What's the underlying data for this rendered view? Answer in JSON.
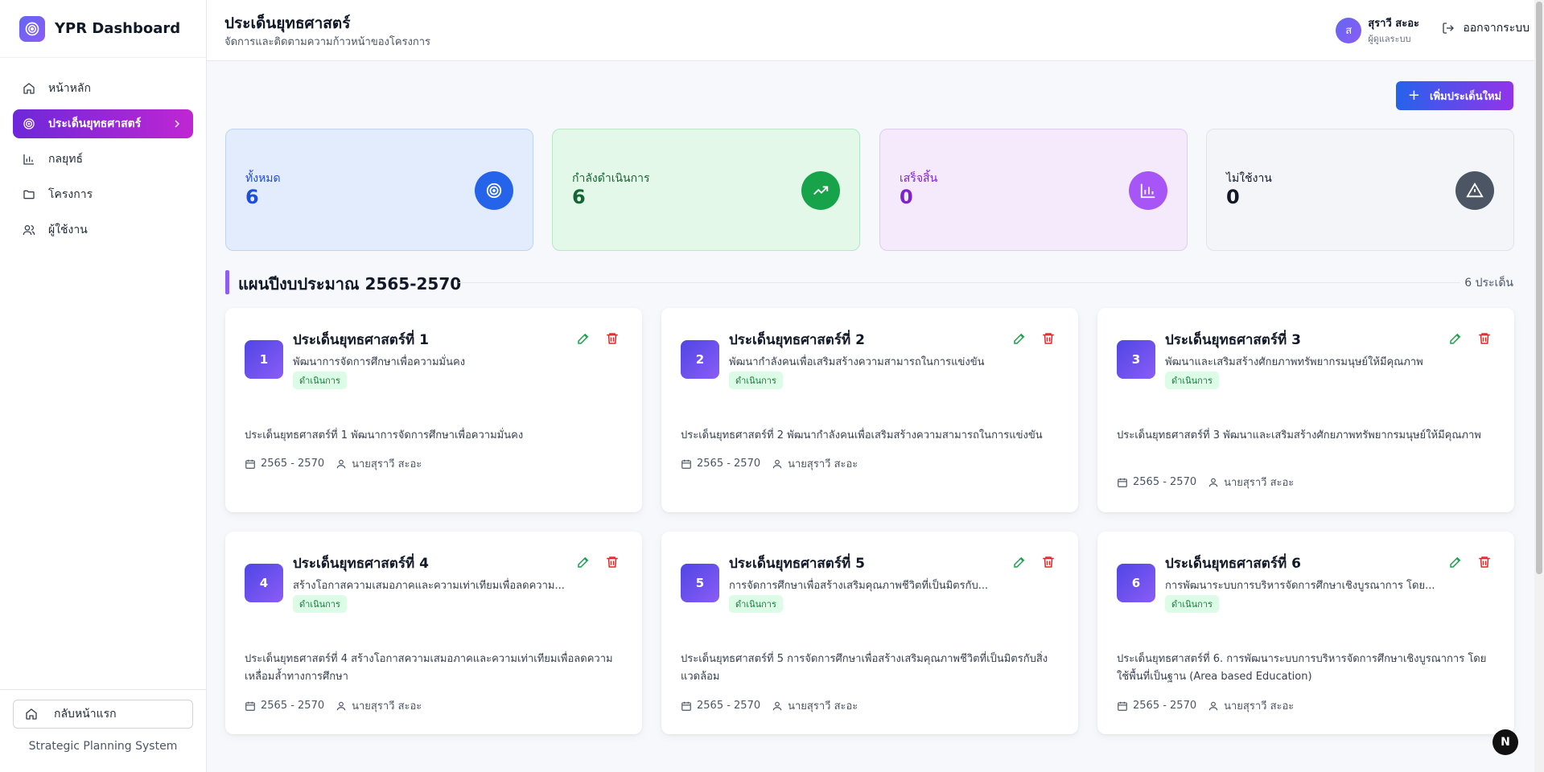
{
  "app": {
    "title": "YPR Dashboard",
    "system_name": "Strategic Planning System"
  },
  "sidebar": {
    "items": [
      {
        "label": "หน้าหลัก",
        "icon": "home-icon"
      },
      {
        "label": "ประเด็นยุทธศาสตร์",
        "icon": "target-icon",
        "active": true
      },
      {
        "label": "กลยุทธ์",
        "icon": "bar-chart-icon"
      },
      {
        "label": "โครงการ",
        "icon": "folder-icon"
      },
      {
        "label": "ผู้ใช้งาน",
        "icon": "users-icon"
      }
    ],
    "footer_button": "กลับหน้าแรก"
  },
  "header": {
    "title": "ประเด็นยุทธศาสตร์",
    "subtitle": "จัดการและติดตามความก้าวหน้าของโครงการ",
    "user": {
      "initial": "ส",
      "name": "สุราวี สะอะ",
      "role": "ผู้ดูแลระบบ"
    },
    "logout_label": "ออกจากระบบ"
  },
  "add_button": "เพิ่มประเด็นใหม่",
  "stats": [
    {
      "label": "ทั้งหมด",
      "value": "6",
      "color": "#1d4ed8",
      "bg": "#e3ecfc",
      "border": "#bfd3f5",
      "icon_bg": "#2563eb",
      "icon": "target-icon"
    },
    {
      "label": "กำลังดำเนินการ",
      "value": "6",
      "color": "#166534",
      "bg": "#e3f8e9",
      "border": "#b6e8c4",
      "icon_bg": "#16a34a",
      "icon": "trending-up-icon"
    },
    {
      "label": "เสร็จสิ้น",
      "value": "0",
      "color": "#7e22ce",
      "bg": "#f5eafc",
      "border": "#e3c9f5",
      "icon_bg": "#a855f7",
      "icon": "bar-chart-icon"
    },
    {
      "label": "ไม่ใช้งาน",
      "value": "0",
      "color": "#111827",
      "bg": "#f3f5f8",
      "border": "#dfe3ea",
      "icon_bg": "#4b5563",
      "icon": "alert-triangle-icon"
    }
  ],
  "section": {
    "title": "แผนปีงบประมาณ 2565-2570",
    "count": "6 ประเด็น"
  },
  "cards": [
    {
      "num": "1",
      "title": "ประเด็นยุทธศาสตร์ที่ 1",
      "sub": "พัฒนาการจัดการศึกษาเพื่อความมั่นคง",
      "badge": "ดำเนินการ",
      "desc": "ประเด็นยุทธศาสตร์ที่ 1 พัฒนาการจัดการศึกษาเพื่อความมั่นคง",
      "years": "2565 - 2570",
      "owner": "นายสุราวี สะอะ"
    },
    {
      "num": "2",
      "title": "ประเด็นยุทธศาสตร์ที่ 2",
      "sub": "พัฒนากำลังคนเพื่อเสริมสร้างความสามารถในการแข่งขัน",
      "badge": "ดำเนินการ",
      "desc": "ประเด็นยุทธศาสตร์ที่ 2 พัฒนากำลังคนเพื่อเสริมสร้างความสามารถในการแข่งขัน",
      "years": "2565 - 2570",
      "owner": "นายสุราวี สะอะ"
    },
    {
      "num": "3",
      "title": "ประเด็นยุทธศาสตร์ที่ 3",
      "sub": "พัฒนาและเสริมสร้างศักยภาพทรัพยากรมนุษย์ให้มีคุณภาพ",
      "badge": "ดำเนินการ",
      "desc": "ประเด็นยุทธศาสตร์ที่ 3 พัฒนาและเสริมสร้างศักยภาพทรัพยากรมนุษย์ให้มีคุณภาพ",
      "years": "2565 - 2570",
      "owner": "นายสุราวี สะอะ"
    },
    {
      "num": "4",
      "title": "ประเด็นยุทธศาสตร์ที่ 4",
      "sub": "สร้างโอกาสความเสมอภาคและความเท่าเทียมเพื่อลดความ...",
      "badge": "ดำเนินการ",
      "desc": "ประเด็นยุทธศาสตร์ที่ 4 สร้างโอกาสความเสมอภาคและความเท่าเทียมเพื่อลดความเหลื่อมล้ำทางการศึกษา",
      "years": "2565 - 2570",
      "owner": "นายสุราวี สะอะ"
    },
    {
      "num": "5",
      "title": "ประเด็นยุทธศาสตร์ที่ 5",
      "sub": "การจัดการศึกษาเพื่อสร้างเสริมคุณภาพชีวิตที่เป็นมิตรกับ...",
      "badge": "ดำเนินการ",
      "desc": "ประเด็นยุทธศาสตร์ที่ 5 การจัดการศึกษาเพื่อสร้างเสริมคุณภาพชีวิตที่เป็นมิตรกับสิ่งแวดล้อม",
      "years": "2565 - 2570",
      "owner": "นายสุราวี สะอะ"
    },
    {
      "num": "6",
      "title": "ประเด็นยุทธศาสตร์ที่ 6",
      "sub": "การพัฒนาระบบการบริหารจัดการศึกษาเชิงบูรณาการ โดย...",
      "badge": "ดำเนินการ",
      "desc": "ประเด็นยุทธศาสตร์ที่ 6. การพัฒนาระบบการบริหารจัดการศึกษาเชิงบูรณาการ โดยใช้พื้นที่เป็นฐาน (Area based Education)",
      "years": "2565 - 2570",
      "owner": "นายสุราวี สะอะ"
    }
  ],
  "fab_label": "N"
}
